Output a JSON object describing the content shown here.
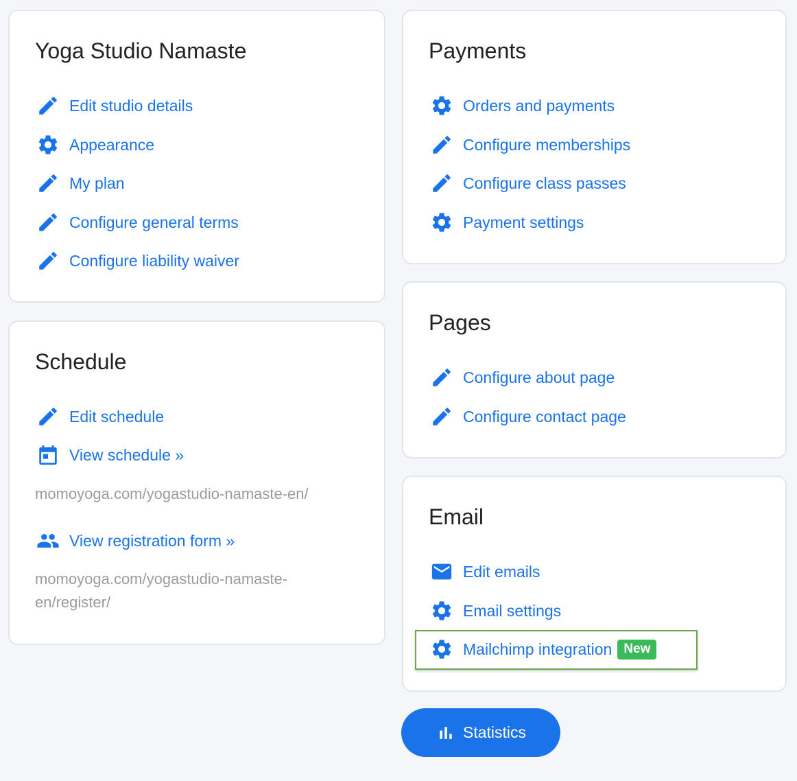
{
  "studio": {
    "title": "Yoga Studio Namaste",
    "links": [
      {
        "label": "Edit studio details",
        "icon": "pencil-icon"
      },
      {
        "label": "Appearance",
        "icon": "gear-icon"
      },
      {
        "label": "My plan",
        "icon": "pencil-icon"
      },
      {
        "label": "Configure general terms",
        "icon": "pencil-icon"
      },
      {
        "label": "Configure liability waiver",
        "icon": "pencil-icon"
      }
    ]
  },
  "schedule": {
    "title": "Schedule",
    "edit_label": "Edit schedule",
    "view_label": "View schedule »",
    "view_url": "momoyoga.com/yogastudio-namaste-en/",
    "register_label": "View registration form »",
    "register_url_line1": "momoyoga.com/yogastudio-namaste-",
    "register_url_line2": "en/register/"
  },
  "payments": {
    "title": "Payments",
    "links": [
      {
        "label": "Orders and payments",
        "icon": "gear-icon"
      },
      {
        "label": "Configure memberships",
        "icon": "pencil-icon"
      },
      {
        "label": "Configure class passes",
        "icon": "pencil-icon"
      },
      {
        "label": "Payment settings",
        "icon": "gear-icon"
      }
    ]
  },
  "pages": {
    "title": "Pages",
    "links": [
      {
        "label": "Configure about page",
        "icon": "pencil-icon"
      },
      {
        "label": "Configure contact page",
        "icon": "pencil-icon"
      }
    ]
  },
  "email": {
    "title": "Email",
    "links": [
      {
        "label": "Edit emails",
        "icon": "envelope-icon"
      },
      {
        "label": "Email settings",
        "icon": "gear-icon"
      },
      {
        "label": "Mailchimp integration",
        "icon": "gear-icon"
      }
    ],
    "badge": "New"
  },
  "statistics": {
    "label": "Statistics",
    "icon": "bar-chart-icon"
  },
  "colors": {
    "accent": "#1a73e8",
    "badge": "#3cb95a",
    "highlight": "#6aa84f",
    "background": "#f5f6fa"
  }
}
